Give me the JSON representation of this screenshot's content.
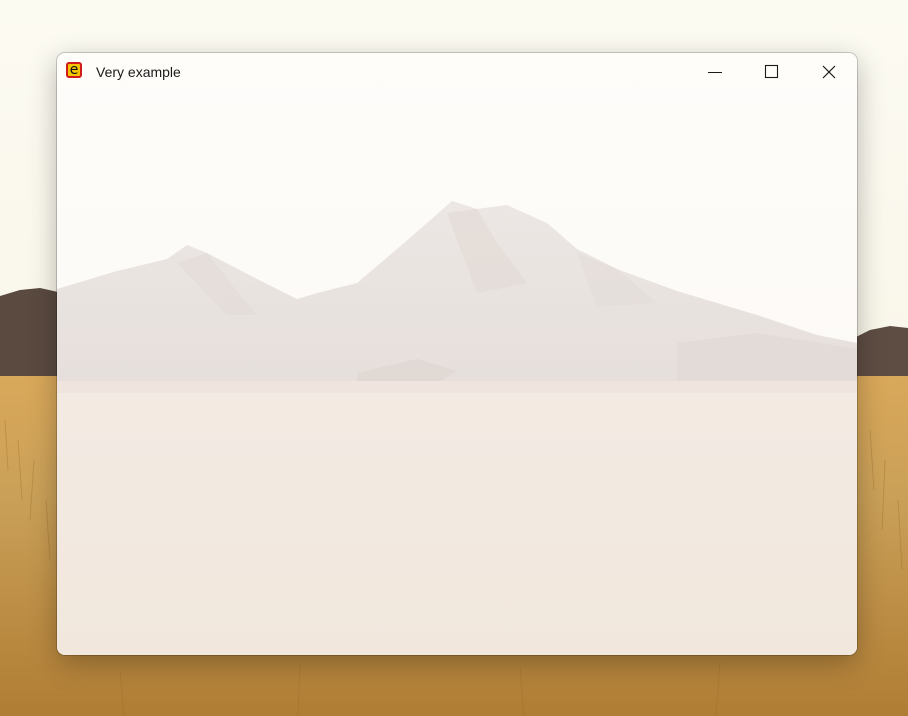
{
  "window": {
    "title": "Very example"
  },
  "app_icon": {
    "glyph": "e",
    "fill": "#f5c400",
    "border": "#d11a1a"
  },
  "controls": {
    "minimize_icon": "minimize-icon",
    "maximize_icon": "maximize-icon",
    "close_icon": "close-icon"
  },
  "wallpaper": {
    "description_icon": "desert-mountain-landscape"
  }
}
